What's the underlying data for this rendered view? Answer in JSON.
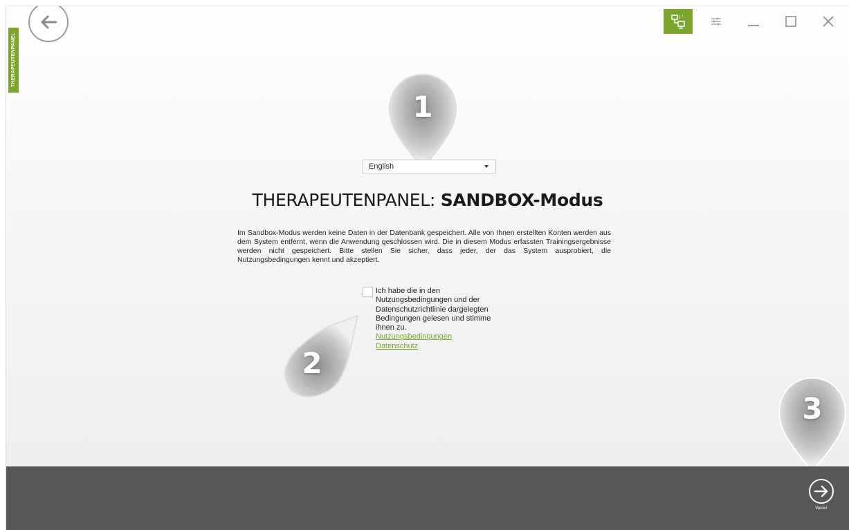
{
  "side_tab": {
    "label": "THERAPEUTENPANEL"
  },
  "language": {
    "selected": "English"
  },
  "title": {
    "prefix": "THERAPEUTENPANEL: ",
    "bold": "SANDBOX-Modus"
  },
  "description": "Im Sandbox-Modus werden keine Daten in der Datenbank gespeichert. Alle von Ihnen erstellten Konten werden aus dem System entfernt, wenn die Anwendung geschlossen wird. Die in diesem Modus erfassten Trainingsergebnisse werden nicht gespeichert. Bitte stellen Sie sicher, dass jeder, der das System ausprobiert, die Nutzungsbedingungen kennt und akzeptiert.",
  "consent": {
    "text": "Ich habe die in den Nutzungsbedingungen und der Datenschutzrichtlinie dargelegten Bedingungen gelesen und stimme ihnen zu.",
    "link_terms": "Nutzungsbedingungen",
    "link_privacy": "Datenschutz",
    "checked": false
  },
  "markers": [
    "1",
    "2",
    "3"
  ],
  "footer": {
    "next_label": "Weiter"
  },
  "colors": {
    "accent": "#7aa62b",
    "footer": "#575757"
  },
  "icons": [
    "back-arrow-icon",
    "monitor-network-icon",
    "settings-sliders-icon",
    "minimize-icon",
    "maximize-icon",
    "close-icon",
    "forward-arrow-icon",
    "dropdown-arrow-icon"
  ]
}
